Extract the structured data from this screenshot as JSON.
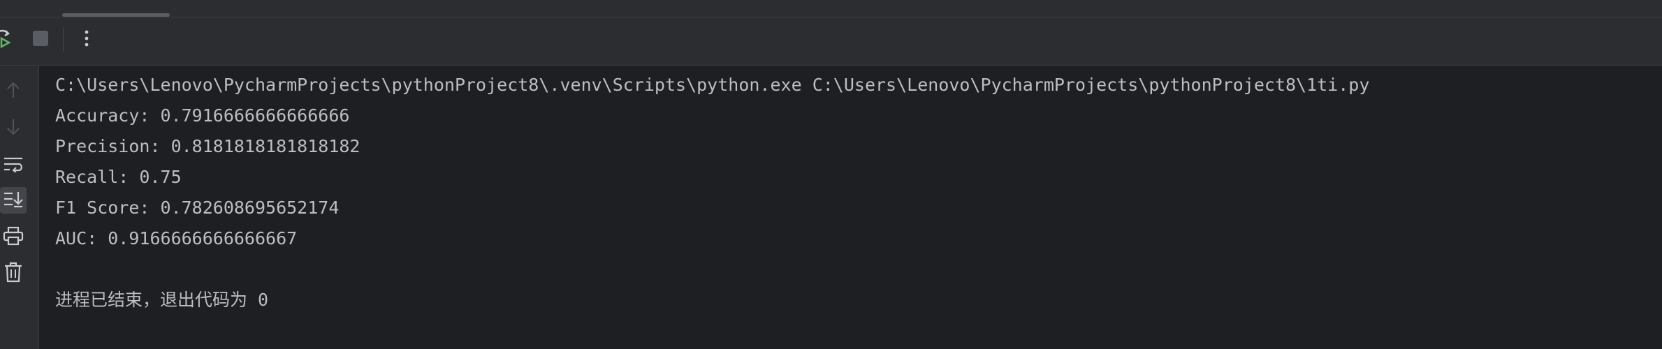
{
  "toolbar": {
    "rerun_icon": "rerun-icon",
    "stop_icon": "stop-icon",
    "more_icon": "more-vertical-icon"
  },
  "gutter": {
    "icons": [
      "arrow-up-icon",
      "arrow-down-icon",
      "soft-wrap-icon",
      "scroll-to-end-icon",
      "print-icon",
      "trash-icon"
    ]
  },
  "console": {
    "command": "C:\\Users\\Lenovo\\PycharmProjects\\pythonProject8\\.venv\\Scripts\\python.exe C:\\Users\\Lenovo\\PycharmProjects\\pythonProject8\\1ti.py",
    "lines": [
      "Accuracy: 0.7916666666666666",
      "Precision: 0.8181818181818182",
      "Recall: 0.75",
      "F1 Score: 0.782608695652174",
      "AUC: 0.9166666666666667"
    ],
    "exit_message": "进程已结束，退出代码为 0"
  },
  "colors": {
    "background": "#1e1f22",
    "panel": "#2b2d30",
    "text": "#bcbec4",
    "run_green": "#5fb865"
  }
}
